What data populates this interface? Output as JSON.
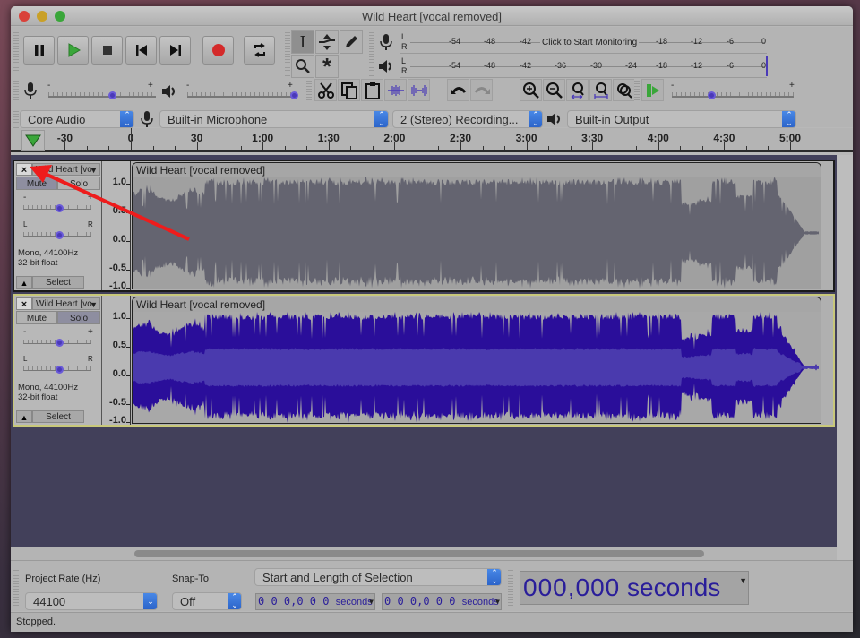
{
  "window": {
    "title": "Wild Heart [vocal removed]"
  },
  "transport": {
    "buttons": [
      {
        "name": "pause-button",
        "icon": "pause-icon"
      },
      {
        "name": "play-button",
        "icon": "play-icon"
      },
      {
        "name": "stop-button",
        "icon": "stop-icon"
      },
      {
        "name": "skip-to-start-button",
        "icon": "skip-start-icon"
      },
      {
        "name": "skip-to-end-button",
        "icon": "skip-end-icon"
      },
      {
        "name": "record-button",
        "icon": "record-icon"
      },
      {
        "name": "loop-button",
        "icon": "loop-icon"
      }
    ]
  },
  "tools": {
    "items": [
      "selection-tool",
      "envelope-tool",
      "draw-tool",
      "zoom-tool",
      "multi-tool"
    ],
    "active": "selection-tool"
  },
  "meters": {
    "record": {
      "channels": [
        "L",
        "R"
      ],
      "scale": [
        "-54",
        "-48",
        "-42",
        "-18",
        "-12",
        "-6",
        "0"
      ],
      "hint": "Click to Start Monitoring"
    },
    "playback": {
      "channels": [
        "L",
        "R"
      ],
      "scale": [
        "-54",
        "-48",
        "-42",
        "-36",
        "-30",
        "-24",
        "-18",
        "-12",
        "-6",
        "0"
      ]
    }
  },
  "mixer": {
    "input_volume": 0.6,
    "output_volume": 1.0,
    "minus": "-",
    "plus": "+"
  },
  "play_at_speed": {
    "value": 0.33,
    "minus": "-",
    "plus": "+"
  },
  "devices": {
    "host": "Core Audio",
    "input": "Built-in Microphone",
    "channels": "2 (Stereo) Recording...",
    "output": "Built-in Output"
  },
  "ruler": {
    "labels": [
      "-30",
      "0",
      "30",
      "1:00",
      "1:30",
      "2:00",
      "2:30",
      "3:00",
      "3:30",
      "4:00",
      "4:30",
      "5:00"
    ]
  },
  "tracks": [
    {
      "name": "Wild Heart [vocal removed]",
      "short_name": "Wild Heart [vo",
      "close": "×",
      "mute": "Mute",
      "solo": "Solo",
      "gain_minus": "-",
      "gain_plus": "+",
      "pan_left": "L",
      "pan_right": "R",
      "gain": 0.5,
      "pan": 0.5,
      "info_line1": "Mono, 44100Hz",
      "info_line2": "32-bit float",
      "select": "Select",
      "scale": [
        "1.0",
        "0.5",
        "0.0",
        "-0.5",
        "-1.0"
      ],
      "selected": false,
      "mute_active": true
    },
    {
      "name": "Wild Heart [vocal removed]",
      "short_name": "Wild Heart [vo",
      "close": "×",
      "mute": "Mute",
      "solo": "Solo",
      "gain_minus": "-",
      "gain_plus": "+",
      "pan_left": "L",
      "pan_right": "R",
      "gain": 0.5,
      "pan": 0.5,
      "info_line1": "Mono, 44100Hz",
      "info_line2": "32-bit float",
      "select": "Select",
      "scale": [
        "1.0",
        "0.5",
        "0.0",
        "-0.5",
        "-1.0"
      ],
      "selected": true,
      "solo_active": true
    }
  ],
  "bottom": {
    "project_rate_label": "Project Rate (Hz)",
    "project_rate": "44100",
    "snap_label": "Snap-To",
    "snap_value": "Off",
    "selection_mode": "Start and Length of Selection",
    "start_digits": "0 0 0,0 0 0",
    "start_unit": "seconds",
    "length_digits": "0 0 0,0 0 0",
    "length_unit": "seconds",
    "audio_position": "000,000",
    "audio_position_unit": "seconds"
  },
  "status": "Stopped.",
  "colors": {
    "waveform_muted": "#646470",
    "waveform_active": "#2a0e9a",
    "waveform_rms": "#4a3aae",
    "record_red": "#d42a2a",
    "play_green": "#3aa63a",
    "annotation_arrow": "#ee1c1c"
  }
}
